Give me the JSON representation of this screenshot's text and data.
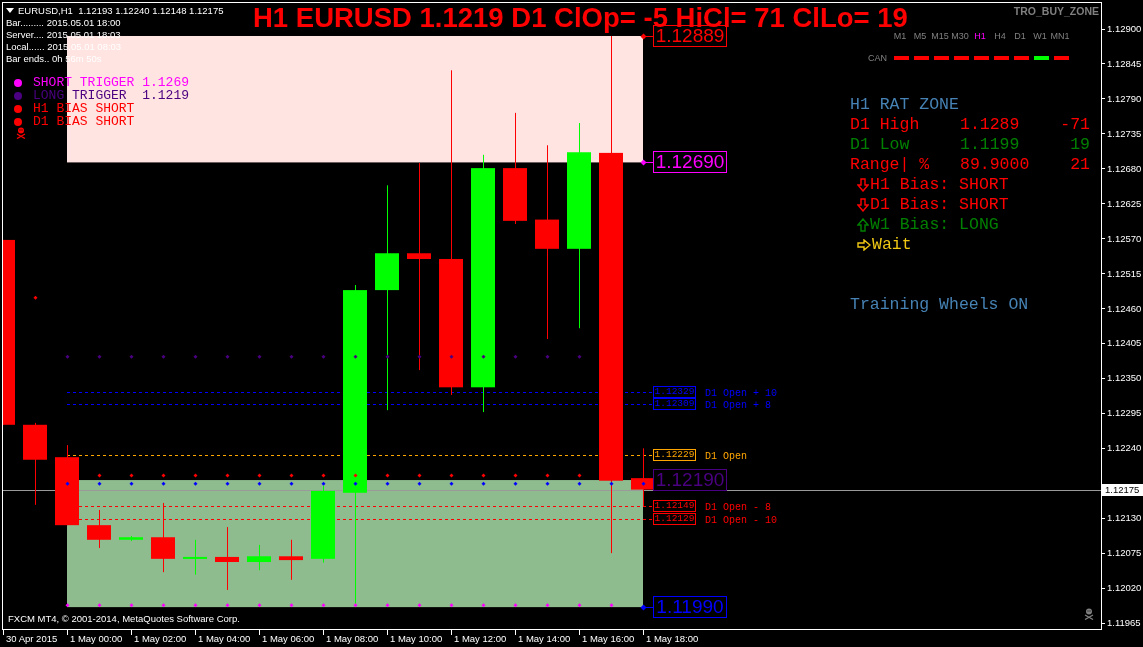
{
  "chart_header": {
    "symbol_line": "EURUSD,H1  1.12193 1.12240 1.12148 1.12175"
  },
  "info_lines": [
    "Bar......... 2015.05.01 18:00",
    "Server.... 2015.05.01 18:03",
    "Local...... 2015.05.01 08:03",
    "Bar ends.. 0h 56m 50s"
  ],
  "legend": [
    {
      "text": "SHORT TRIGGER 1.1269",
      "color": "#ff00ff"
    },
    {
      "text": "LONG TRIGGER  1.1219",
      "color": "#4b0082"
    },
    {
      "text": "H1 BIAS SHORT",
      "color": "#ff0000"
    },
    {
      "text": "D1 BIAS SHORT",
      "color": "#ff0000"
    }
  ],
  "title": "H1 EURUSD 1.1219 D1 ClOp= -5 HiCl= 71 ClLo= 19",
  "indicator_name": "TRO_BUY_ZONE",
  "timeframes": [
    {
      "label": "M1",
      "selected": false
    },
    {
      "label": "M5",
      "selected": false
    },
    {
      "label": "M15",
      "selected": false
    },
    {
      "label": "M30",
      "selected": false
    },
    {
      "label": "H1",
      "selected": true
    },
    {
      "label": "H4",
      "selected": false
    },
    {
      "label": "D1",
      "selected": false
    },
    {
      "label": "W1",
      "selected": false
    },
    {
      "label": "MN1",
      "selected": false
    }
  ],
  "can_row": {
    "label": "CAN",
    "segments": [
      {
        "color": "#ff0000"
      },
      {
        "color": "#ff0000"
      },
      {
        "color": "#ff0000"
      },
      {
        "color": "#ff0000"
      },
      {
        "color": "#ff0000"
      },
      {
        "color": "#ff0000"
      },
      {
        "color": "#ff0000"
      },
      {
        "color": "#00ff00"
      },
      {
        "color": "#ff0000"
      }
    ]
  },
  "rat_zone": {
    "title": "H1 RAT ZONE",
    "rows": [
      {
        "label": "D1 High",
        "value": "1.1289",
        "delta": "-71",
        "color": "#ff0000"
      },
      {
        "label": "D1 Low",
        "value": "1.1199",
        "delta": "19",
        "color": "#008000"
      },
      {
        "label": "Range| %",
        "value": "89.9000",
        "delta": "21",
        "color": "#ff0000"
      }
    ],
    "bias": [
      {
        "kind": "down",
        "text": "H1 Bias: SHORT",
        "color": "#ff0000"
      },
      {
        "kind": "down",
        "text": "D1 Bias: SHORT",
        "color": "#ff0000"
      },
      {
        "kind": "up",
        "text": "W1 Bias: LONG",
        "color": "#008000"
      },
      {
        "kind": "right",
        "text": "Wait",
        "color": "#f0c814"
      }
    ],
    "footer": "Training Wheels ON"
  },
  "zones": [
    {
      "color": "#ffe4e1",
      "edges": [
        {
          "label": "1.12889",
          "color": "#ff0000"
        },
        {
          "label": "1.12690",
          "color": "#ff00ff"
        }
      ]
    },
    {
      "color": "#8fbc8f",
      "edges": [
        {
          "label": "1.12190",
          "color": "#4b0082"
        },
        {
          "label": "1.11990",
          "color": "#0000ff"
        }
      ]
    }
  ],
  "levels": [
    {
      "label": "1.12329",
      "text": "D1 Open + 10",
      "color": "#0000ff"
    },
    {
      "label": "1.12309",
      "text": "D1 Open + 8",
      "color": "#0000ff"
    },
    {
      "label": "1.12229",
      "text": "D1 Open",
      "color": "#ffa500"
    },
    {
      "label": "1.12149",
      "text": "D1 Open - 8",
      "color": "#ff0000"
    },
    {
      "label": "1.12129",
      "text": "D1 Open - 10",
      "color": "#ff0000"
    }
  ],
  "price_axis": {
    "labels": [
      "1.12900",
      "1.12845",
      "1.12790",
      "1.12735",
      "1.12680",
      "1.12625",
      "1.12570",
      "1.12515",
      "1.12460",
      "1.12405",
      "1.12350",
      "1.12295",
      "1.12240",
      "1.12130",
      "1.12075",
      "1.12020",
      "1.11965"
    ],
    "current": "1.12175"
  },
  "time_axis": {
    "labels": [
      "30 Apr 2015",
      "1 May 00:00",
      "1 May 02:00",
      "1 May 04:00",
      "1 May 06:00",
      "1 May 08:00",
      "1 May 10:00",
      "1 May 12:00",
      "1 May 14:00",
      "1 May 16:00",
      "1 May 18:00"
    ]
  },
  "copyright": "FXCM MT4, © 2001-2014, MetaQuotes Software Corp."
}
